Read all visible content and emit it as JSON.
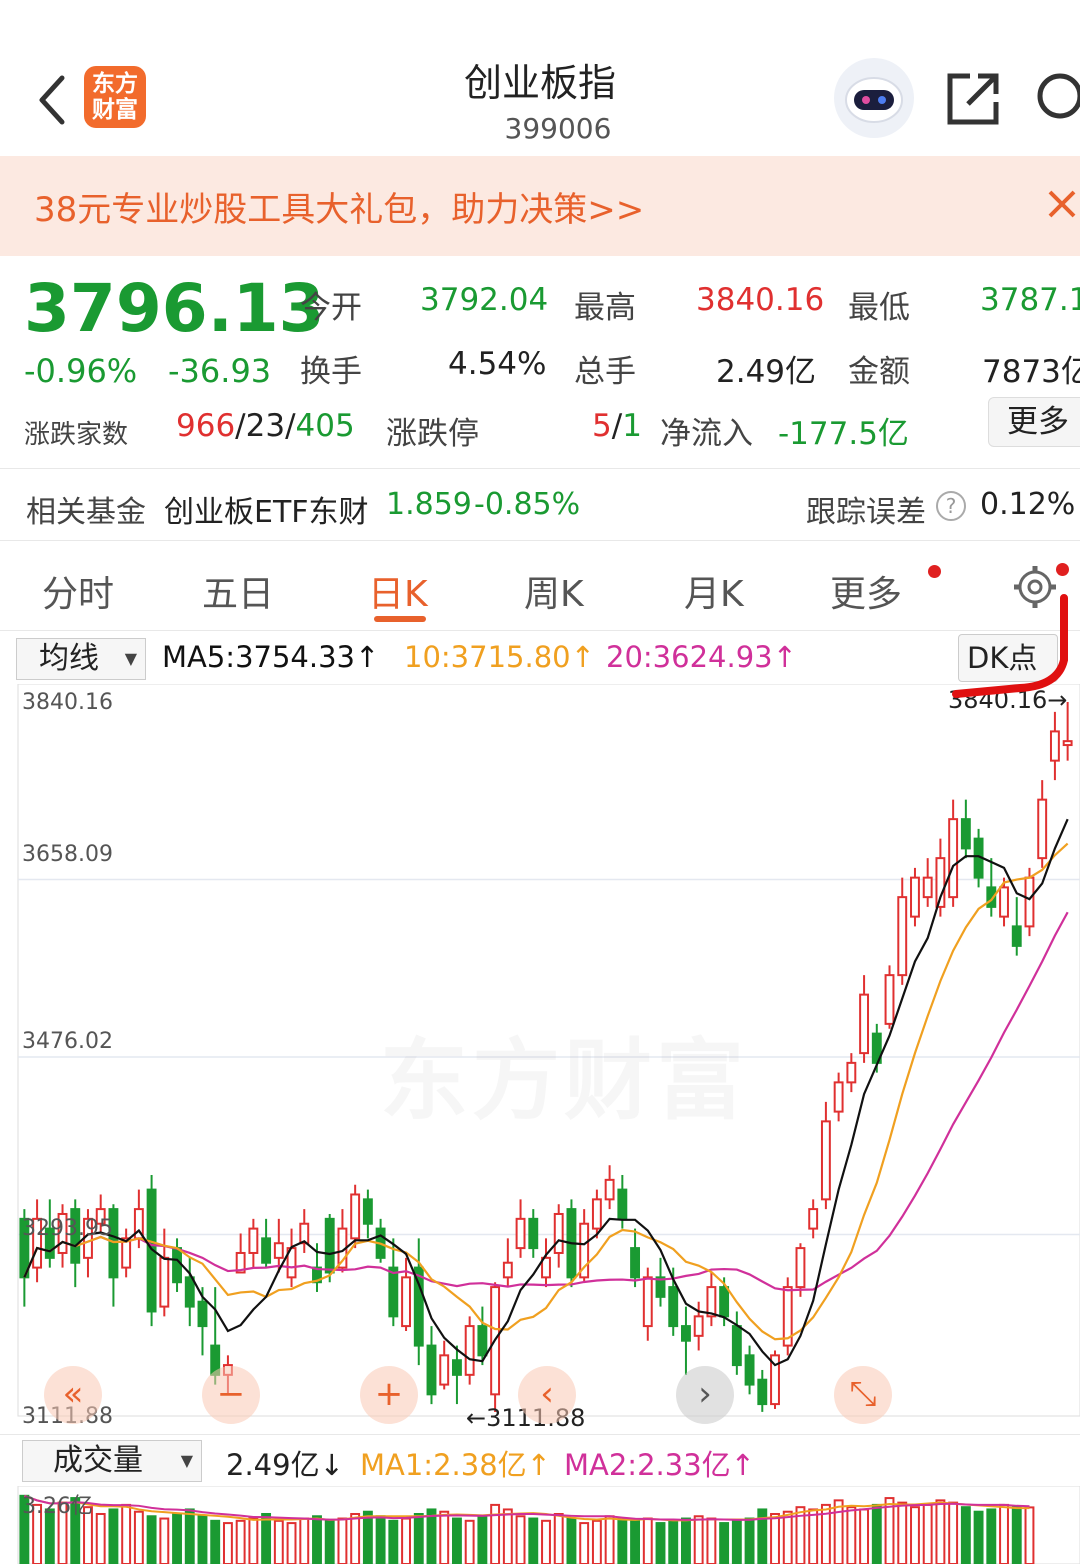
{
  "header": {
    "logo_text": "东方财富",
    "title": "创业板指",
    "code": "399006"
  },
  "banner": {
    "text": "38元专业炒股工具大礼包，助力决策>>"
  },
  "quote": {
    "price": "3796.13",
    "change_pct": "-0.96%",
    "change": "-36.93",
    "open_label": "今开",
    "open": "3792.04",
    "high_label": "最高",
    "high": "3840.16",
    "low_label": "最低",
    "low": "3787.1",
    "turnover_label": "换手",
    "turnover": "4.54%",
    "volume_label": "总手",
    "volume": "2.49亿",
    "amount_label": "金额",
    "amount": "7873亿",
    "breadth_label": "涨跌家数",
    "breadth_up": "966",
    "breadth_flat": "23",
    "breadth_down": "405",
    "limit_label": "涨跌停",
    "limit_up": "5",
    "limit_down": "1",
    "inflow_label": "净流入",
    "inflow": "-177.5亿",
    "more_label": "更多"
  },
  "fund": {
    "label": "相关基金",
    "name": "创业板ETF东财",
    "price": "1.859",
    "change": "-0.85%",
    "tracking_label": "跟踪误差",
    "tracking_value": "0.12%"
  },
  "tabs": [
    "分时",
    "五日",
    "日K",
    "周K",
    "月K",
    "更多"
  ],
  "active_tab": "日K",
  "ma_row": {
    "select": "均线",
    "ma5": "MA5:3754.33↑",
    "ma10": "10:3715.80↑",
    "ma20": "20:3624.93↑",
    "dk": "DK点"
  },
  "chart_labels": {
    "y_ticks": [
      "3840.16",
      "3658.09",
      "3476.02",
      "3293.95",
      "3111.88"
    ],
    "min_marker": "←3111.88",
    "max_marker": "3840.16→",
    "watermark": "东方财富"
  },
  "controls": [
    "«",
    "−",
    "+",
    "‹",
    "›",
    "⤡"
  ],
  "volume_row": {
    "select": "成交量",
    "value": "2.49亿↓",
    "ma1": "MA1:2.38亿↑",
    "ma2": "MA2:2.33亿↑",
    "y_top": "3.26亿"
  },
  "colors": {
    "up": "#e03030",
    "down": "#1a9a32",
    "accent": "#e8612c",
    "ma5": "#111111",
    "ma10": "#f0a020",
    "ma20": "#d0309a"
  },
  "chart_data": {
    "type": "candlestick",
    "ylim": [
      3111.88,
      3840.16
    ],
    "candles": [
      {
        "o": 3310,
        "c": 3250,
        "h": 3320,
        "l": 3220
      },
      {
        "o": 3260,
        "c": 3310,
        "h": 3330,
        "l": 3245
      },
      {
        "o": 3300,
        "c": 3270,
        "h": 3330,
        "l": 3260
      },
      {
        "o": 3275,
        "c": 3315,
        "h": 3325,
        "l": 3260
      },
      {
        "o": 3320,
        "c": 3265,
        "h": 3330,
        "l": 3240
      },
      {
        "o": 3270,
        "c": 3310,
        "h": 3320,
        "l": 3250
      },
      {
        "o": 3305,
        "c": 3320,
        "h": 3335,
        "l": 3295
      },
      {
        "o": 3320,
        "c": 3250,
        "h": 3325,
        "l": 3220
      },
      {
        "o": 3260,
        "c": 3290,
        "h": 3300,
        "l": 3250
      },
      {
        "o": 3290,
        "c": 3320,
        "h": 3340,
        "l": 3280
      },
      {
        "o": 3340,
        "c": 3215,
        "h": 3355,
        "l": 3200
      },
      {
        "o": 3220,
        "c": 3270,
        "h": 3300,
        "l": 3210
      },
      {
        "o": 3280,
        "c": 3245,
        "h": 3290,
        "l": 3235
      },
      {
        "o": 3250,
        "c": 3220,
        "h": 3270,
        "l": 3200
      },
      {
        "o": 3225,
        "c": 3200,
        "h": 3240,
        "l": 3170
      },
      {
        "o": 3180,
        "c": 3150,
        "h": 3240,
        "l": 3140
      },
      {
        "o": 3150,
        "c": 3160,
        "h": 3170,
        "l": 3130
      },
      {
        "o": 3255,
        "c": 3275,
        "h": 3295,
        "l": 3255
      },
      {
        "o": 3275,
        "c": 3300,
        "h": 3310,
        "l": 3260
      },
      {
        "o": 3290,
        "c": 3265,
        "h": 3310,
        "l": 3260
      },
      {
        "o": 3270,
        "c": 3285,
        "h": 3310,
        "l": 3255
      },
      {
        "o": 3250,
        "c": 3280,
        "h": 3300,
        "l": 3240
      },
      {
        "o": 3285,
        "c": 3305,
        "h": 3320,
        "l": 3275
      },
      {
        "o": 3260,
        "c": 3245,
        "h": 3285,
        "l": 3235
      },
      {
        "o": 3310,
        "c": 3255,
        "h": 3315,
        "l": 3245
      },
      {
        "o": 3260,
        "c": 3300,
        "h": 3320,
        "l": 3255
      },
      {
        "o": 3290,
        "c": 3335,
        "h": 3345,
        "l": 3280
      },
      {
        "o": 3330,
        "c": 3305,
        "h": 3340,
        "l": 3290
      },
      {
        "o": 3300,
        "c": 3270,
        "h": 3310,
        "l": 3265
      },
      {
        "o": 3260,
        "c": 3210,
        "h": 3290,
        "l": 3200
      },
      {
        "o": 3200,
        "c": 3250,
        "h": 3270,
        "l": 3195
      },
      {
        "o": 3260,
        "c": 3180,
        "h": 3290,
        "l": 3160
      },
      {
        "o": 3180,
        "c": 3130,
        "h": 3200,
        "l": 3120
      },
      {
        "o": 3140,
        "c": 3170,
        "h": 3185,
        "l": 3135
      },
      {
        "o": 3165,
        "c": 3150,
        "h": 3180,
        "l": 3120
      },
      {
        "o": 3150,
        "c": 3200,
        "h": 3210,
        "l": 3140
      },
      {
        "o": 3200,
        "c": 3170,
        "h": 3220,
        "l": 3160
      },
      {
        "o": 3130,
        "c": 3240,
        "h": 3245,
        "l": 3111.88
      },
      {
        "o": 3250,
        "c": 3265,
        "h": 3290,
        "l": 3240
      },
      {
        "o": 3280,
        "c": 3310,
        "h": 3330,
        "l": 3270
      },
      {
        "o": 3310,
        "c": 3280,
        "h": 3320,
        "l": 3270
      },
      {
        "o": 3250,
        "c": 3270,
        "h": 3290,
        "l": 3240
      },
      {
        "o": 3275,
        "c": 3315,
        "h": 3325,
        "l": 3260
      },
      {
        "o": 3320,
        "c": 3250,
        "h": 3330,
        "l": 3240
      },
      {
        "o": 3250,
        "c": 3305,
        "h": 3320,
        "l": 3245
      },
      {
        "o": 3300,
        "c": 3330,
        "h": 3340,
        "l": 3290
      },
      {
        "o": 3330,
        "c": 3350,
        "h": 3365,
        "l": 3320
      },
      {
        "o": 3340,
        "c": 3310,
        "h": 3355,
        "l": 3300
      },
      {
        "o": 3280,
        "c": 3250,
        "h": 3300,
        "l": 3240
      },
      {
        "o": 3200,
        "c": 3250,
        "h": 3260,
        "l": 3185
      },
      {
        "o": 3250,
        "c": 3230,
        "h": 3270,
        "l": 3220
      },
      {
        "o": 3240,
        "c": 3200,
        "h": 3260,
        "l": 3190
      },
      {
        "o": 3200,
        "c": 3185,
        "h": 3220,
        "l": 3150
      },
      {
        "o": 3190,
        "c": 3210,
        "h": 3225,
        "l": 3175
      },
      {
        "o": 3210,
        "c": 3240,
        "h": 3255,
        "l": 3200
      },
      {
        "o": 3240,
        "c": 3210,
        "h": 3250,
        "l": 3200
      },
      {
        "o": 3200,
        "c": 3160,
        "h": 3215,
        "l": 3150
      },
      {
        "o": 3170,
        "c": 3140,
        "h": 3180,
        "l": 3130
      },
      {
        "o": 3145,
        "c": 3120,
        "h": 3155,
        "l": 3112
      },
      {
        "o": 3120,
        "c": 3170,
        "h": 3175,
        "l": 3115
      },
      {
        "o": 3180,
        "c": 3240,
        "h": 3250,
        "l": 3170
      },
      {
        "o": 3240,
        "c": 3280,
        "h": 3285,
        "l": 3230
      },
      {
        "o": 3300,
        "c": 3320,
        "h": 3330,
        "l": 3290
      },
      {
        "o": 3330,
        "c": 3410,
        "h": 3430,
        "l": 3320
      },
      {
        "o": 3420,
        "c": 3450,
        "h": 3460,
        "l": 3410
      },
      {
        "o": 3450,
        "c": 3470,
        "h": 3480,
        "l": 3440
      },
      {
        "o": 3480,
        "c": 3540,
        "h": 3560,
        "l": 3470
      },
      {
        "o": 3500,
        "c": 3470,
        "h": 3510,
        "l": 3460
      },
      {
        "o": 3510,
        "c": 3560,
        "h": 3570,
        "l": 3505
      },
      {
        "o": 3560,
        "c": 3640,
        "h": 3660,
        "l": 3550
      },
      {
        "o": 3620,
        "c": 3660,
        "h": 3670,
        "l": 3610
      },
      {
        "o": 3640,
        "c": 3660,
        "h": 3680,
        "l": 3630
      },
      {
        "o": 3630,
        "c": 3680,
        "h": 3700,
        "l": 3620
      },
      {
        "o": 3640,
        "c": 3720,
        "h": 3740,
        "l": 3630
      },
      {
        "o": 3720,
        "c": 3690,
        "h": 3740,
        "l": 3680
      },
      {
        "o": 3700,
        "c": 3660,
        "h": 3710,
        "l": 3650
      },
      {
        "o": 3650,
        "c": 3630,
        "h": 3680,
        "l": 3620
      },
      {
        "o": 3620,
        "c": 3650,
        "h": 3660,
        "l": 3610
      },
      {
        "o": 3610,
        "c": 3590,
        "h": 3640,
        "l": 3580
      },
      {
        "o": 3610,
        "c": 3660,
        "h": 3670,
        "l": 3600
      },
      {
        "o": 3680,
        "c": 3740,
        "h": 3760,
        "l": 3670
      },
      {
        "o": 3780,
        "c": 3810,
        "h": 3830,
        "l": 3760
      },
      {
        "o": 3796,
        "c": 3800,
        "h": 3840.16,
        "l": 3780
      }
    ],
    "volume": [
      3.0,
      2.6,
      2.4,
      2.7,
      2.9,
      2.5,
      2.2,
      2.4,
      2.6,
      2.3,
      2.1,
      2.0,
      2.2,
      2.4,
      2.1,
      1.9,
      1.8,
      1.9,
      2.0,
      2.2,
      1.9,
      1.8,
      2.0,
      2.1,
      1.9,
      2.0,
      2.2,
      2.3,
      2.1,
      1.9,
      2.0,
      2.2,
      2.4,
      2.3,
      2.0,
      1.9,
      2.1,
      2.6,
      2.4,
      2.1,
      2.0,
      1.9,
      2.2,
      2.0,
      1.8,
      1.9,
      2.1,
      2.0,
      1.9,
      2.0,
      1.8,
      1.9,
      2.0,
      2.1,
      2.0,
      1.8,
      1.9,
      2.0,
      2.4,
      2.2,
      2.3,
      2.5,
      2.4,
      2.6,
      2.8,
      2.5,
      2.4,
      2.6,
      2.9,
      2.7,
      2.5,
      2.6,
      2.8,
      2.7,
      2.5,
      2.3,
      2.4,
      2.6,
      2.5,
      2.49
    ]
  }
}
